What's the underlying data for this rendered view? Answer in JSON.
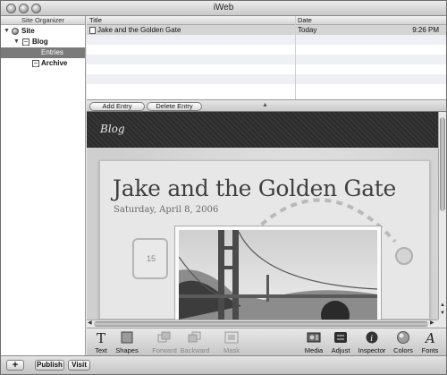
{
  "window": {
    "title": "iWeb"
  },
  "sidebar": {
    "header": "Site Organizer",
    "items": [
      {
        "label": "Site"
      },
      {
        "label": "Blog"
      },
      {
        "label": "Entries"
      },
      {
        "label": "Archive"
      }
    ]
  },
  "entries": {
    "columns": {
      "title": "Title",
      "date": "Date"
    },
    "rows": [
      {
        "title": "Jake and the Golden Gate",
        "date": "Today",
        "time": "9:26 PM"
      }
    ],
    "add_label": "Add Entry",
    "delete_label": "Delete Entry"
  },
  "canvas": {
    "banner": "Blog",
    "post_title": "Jake and the Golden Gate",
    "post_date": "Saturday, April 8, 2006",
    "calendar_day": "15"
  },
  "toolbar": {
    "items": [
      {
        "label": "Text",
        "icon": "text-icon"
      },
      {
        "label": "Shapes",
        "icon": "shapes-icon"
      },
      {
        "label": "Forward",
        "icon": "forward-icon"
      },
      {
        "label": "Backward",
        "icon": "backward-icon"
      },
      {
        "label": "Mask",
        "icon": "mask-icon"
      },
      {
        "label": "Media",
        "icon": "media-icon"
      },
      {
        "label": "Adjust",
        "icon": "adjust-icon"
      },
      {
        "label": "Inspector",
        "icon": "inspector-icon"
      },
      {
        "label": "Colors",
        "icon": "colors-icon"
      },
      {
        "label": "Fonts",
        "icon": "fonts-icon"
      }
    ]
  },
  "footer": {
    "add_label": "+",
    "publish_label": "Publish",
    "visit_label": "Visit"
  }
}
